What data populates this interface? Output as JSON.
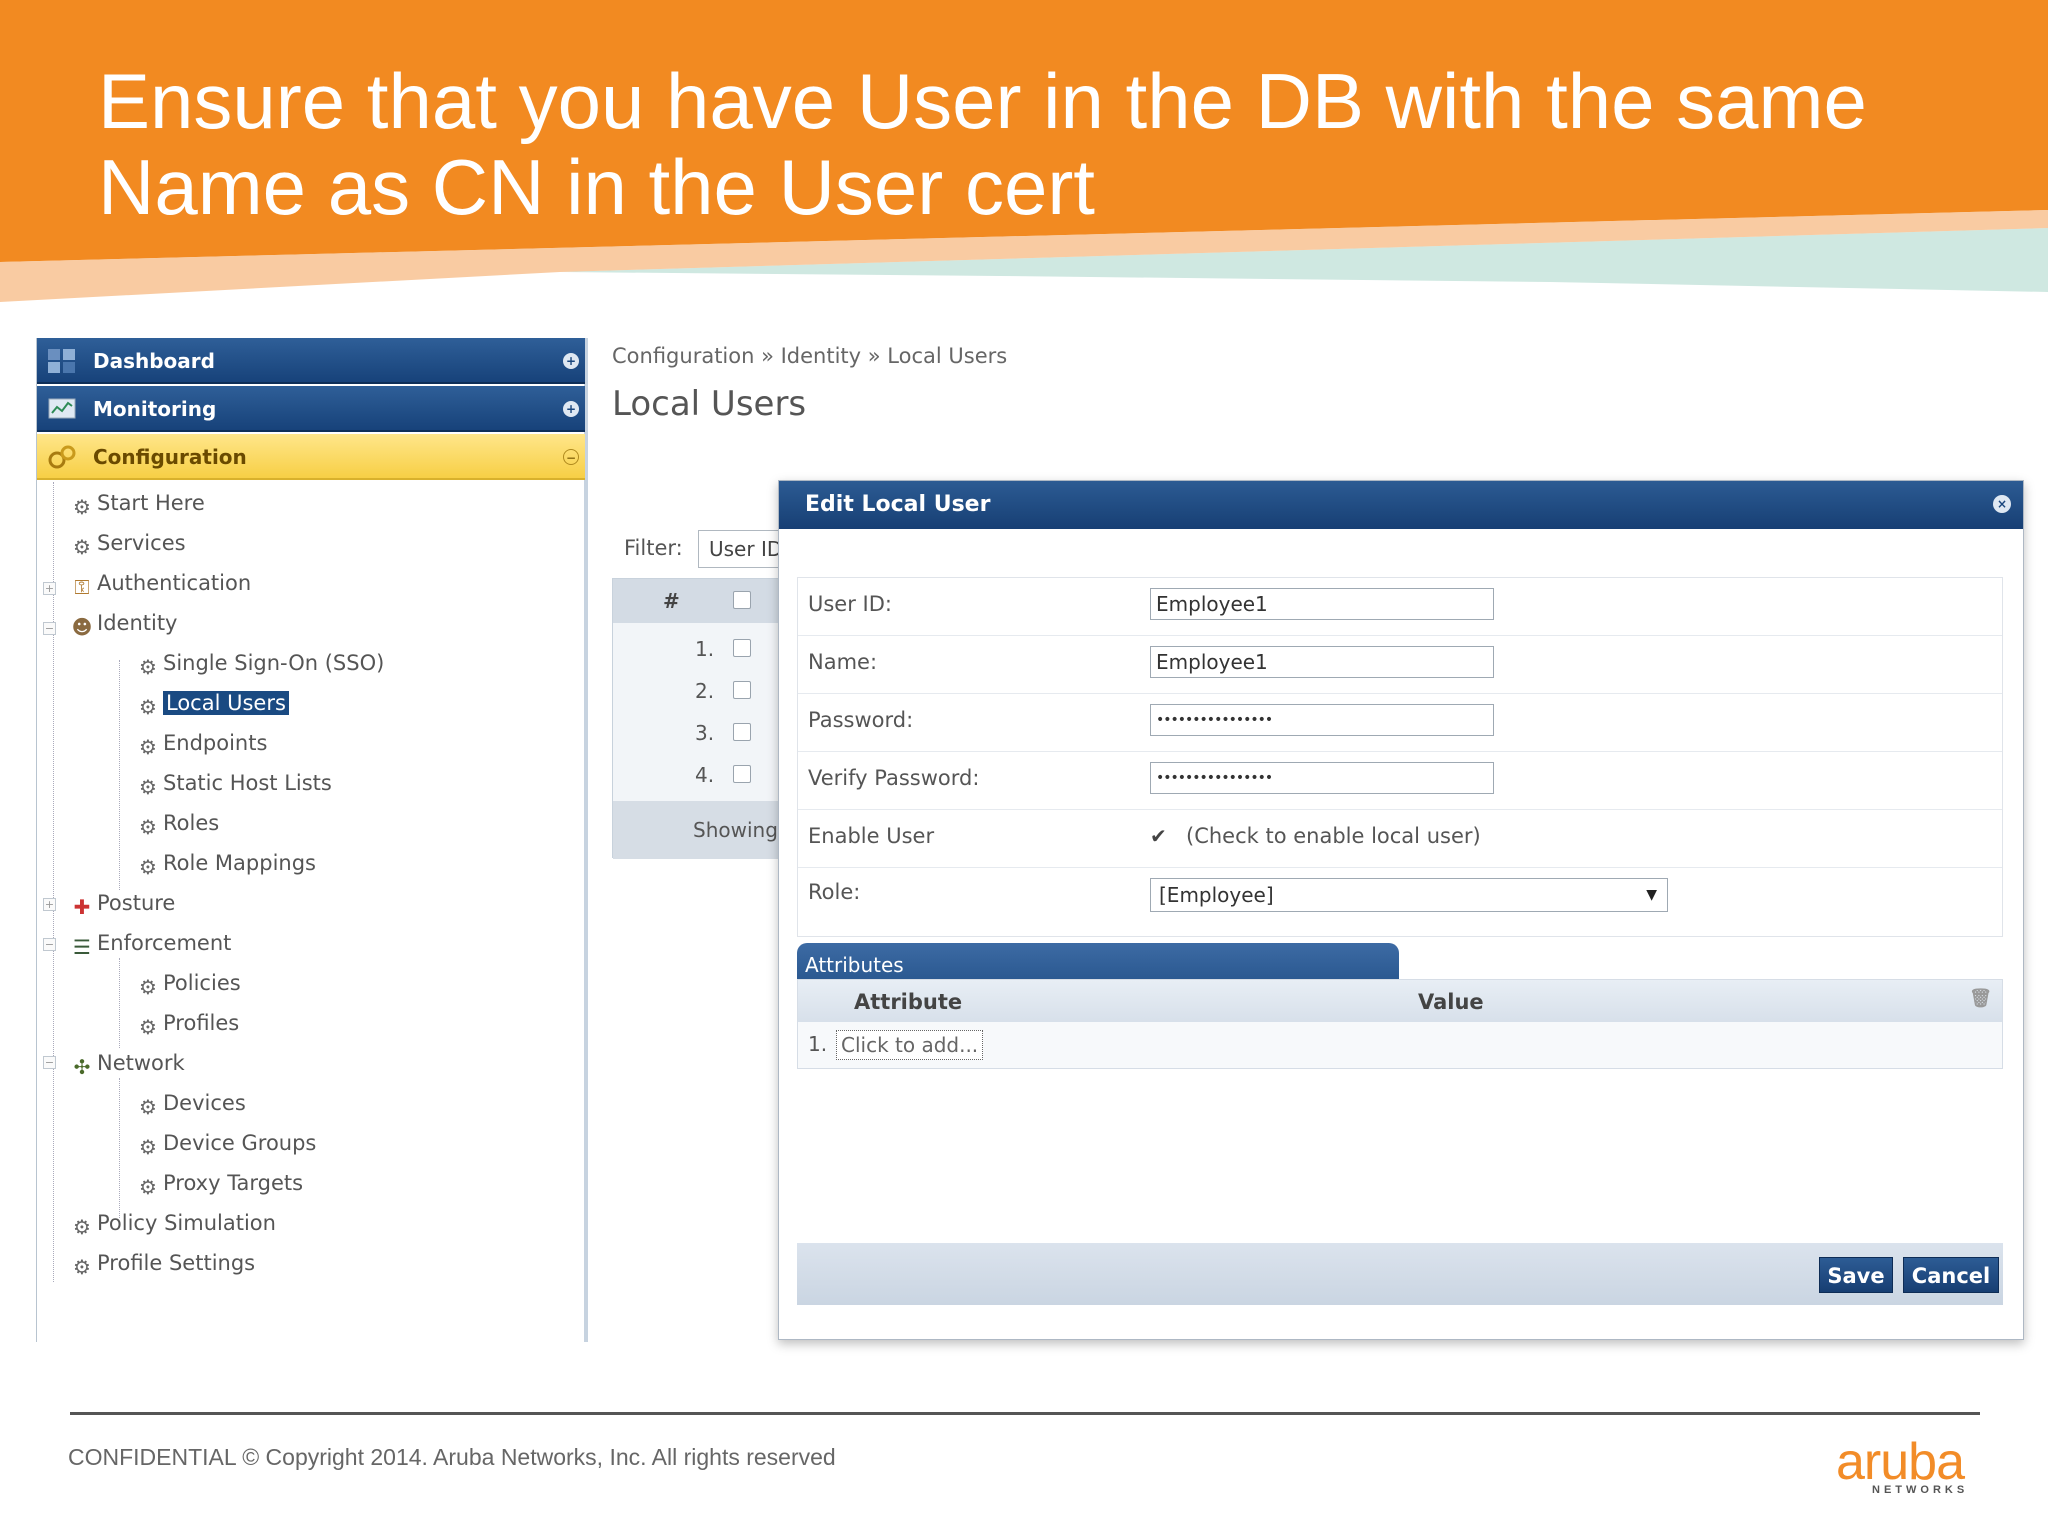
{
  "slide": {
    "title_line1": "Ensure that you have User in the DB with the same",
    "title_line2": "Name as CN in the User cert",
    "footer": "CONFIDENTIAL © Copyright 2014. Aruba Networks, Inc. All rights reserved",
    "logo": "aruba",
    "logo_sub": "NETWORKS",
    "colors": {
      "banner": "#f28a21",
      "accent_teal": "#c9e6df",
      "logo": "#f28c28"
    }
  },
  "nav": {
    "headers": [
      {
        "label": "Dashboard",
        "icon": "dashboard-icon"
      },
      {
        "label": "Monitoring",
        "icon": "monitor-icon"
      },
      {
        "label": "Configuration",
        "icon": "configuration-icon"
      }
    ],
    "items": [
      {
        "label": "Start Here",
        "icon": "gear-icon"
      },
      {
        "label": "Services",
        "icon": "gear-icon"
      },
      {
        "label": "Authentication",
        "icon": "authentication-icon"
      },
      {
        "label": "Identity",
        "icon": "identity-icon"
      },
      {
        "label": "Single Sign-On (SSO)",
        "icon": "gear-icon"
      },
      {
        "label": "Local Users",
        "icon": "gear-icon"
      },
      {
        "label": "Endpoints",
        "icon": "gear-icon"
      },
      {
        "label": "Static Host Lists",
        "icon": "gear-icon"
      },
      {
        "label": "Roles",
        "icon": "gear-icon"
      },
      {
        "label": "Role Mappings",
        "icon": "gear-icon"
      },
      {
        "label": "Posture",
        "icon": "posture-icon"
      },
      {
        "label": "Enforcement",
        "icon": "enforcement-icon"
      },
      {
        "label": "Policies",
        "icon": "gear-icon"
      },
      {
        "label": "Profiles",
        "icon": "gear-icon"
      },
      {
        "label": "Network",
        "icon": "network-icon"
      },
      {
        "label": "Devices",
        "icon": "gear-icon"
      },
      {
        "label": "Device Groups",
        "icon": "gear-icon"
      },
      {
        "label": "Proxy Targets",
        "icon": "gear-icon"
      },
      {
        "label": "Policy Simulation",
        "icon": "gear-icon"
      },
      {
        "label": "Profile Settings",
        "icon": "gear-icon"
      }
    ]
  },
  "page": {
    "breadcrumb": "Configuration » Identity » Local Users",
    "heading": "Local Users",
    "filter_label": "Filter:",
    "filter_value": "User ID",
    "table_header_num": "#",
    "rows": [
      "1.",
      "2.",
      "3.",
      "4."
    ],
    "showing": "Showing"
  },
  "dialog": {
    "title": "Edit Local User",
    "fields": {
      "user_id_label": "User ID:",
      "user_id_value": "Employee1",
      "name_label": "Name:",
      "name_value": "Employee1",
      "password_label": "Password:",
      "password_value": "••••••••••••••••",
      "verify_label": "Verify Password:",
      "verify_value": "••••••••••••••••",
      "enable_label": "Enable User",
      "enable_hint": "(Check to enable local user)",
      "enable_checked": true,
      "role_label": "Role:",
      "role_value": "[Employee]"
    },
    "attributes_tab": "Attributes",
    "attr_col_attribute": "Attribute",
    "attr_col_value": "Value",
    "attr_row_num": "1.",
    "attr_add": "Click to add...",
    "save": "Save",
    "cancel": "Cancel"
  }
}
